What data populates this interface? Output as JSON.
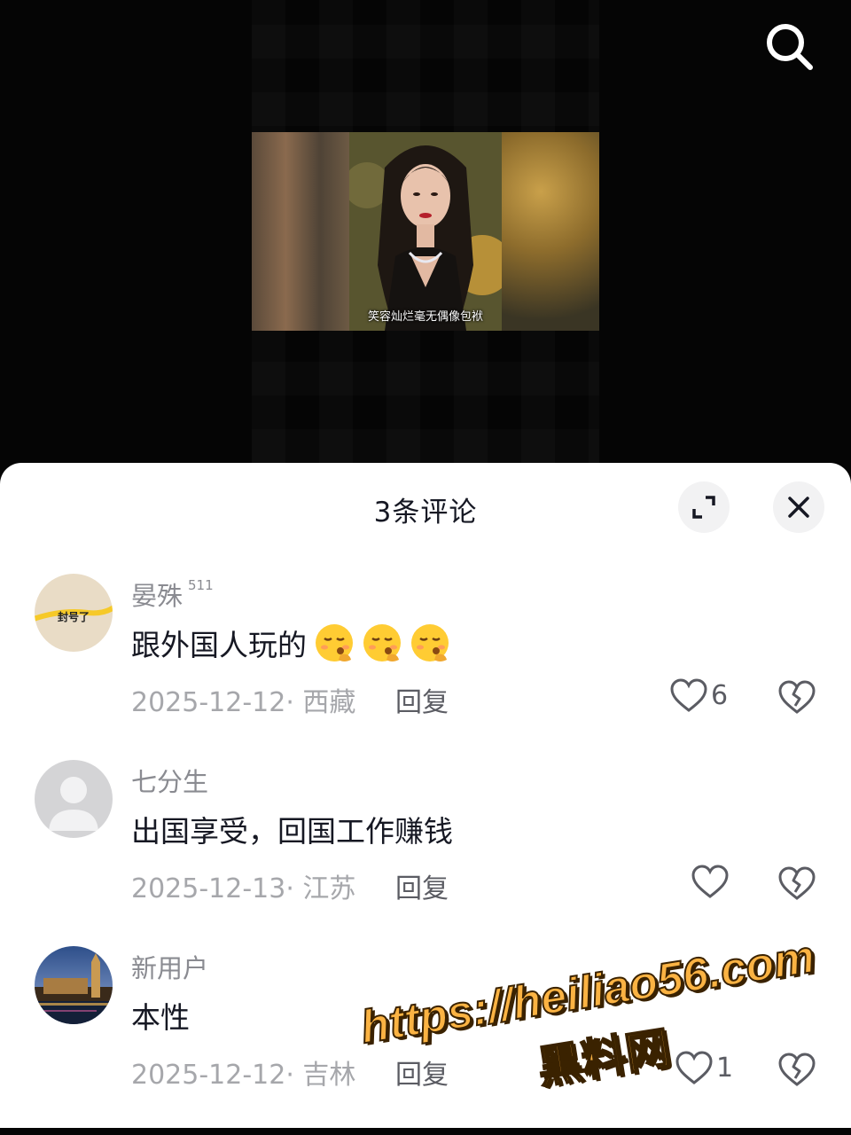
{
  "video": {
    "caption": "笑容灿烂毫无偶像包袱"
  },
  "header": {
    "title": "3条评论"
  },
  "comments": [
    {
      "username": "晏殊",
      "level": "511",
      "avatar_text": "封号了",
      "text": "跟外国人玩的",
      "emojis": [
        "kissing-face-emoji",
        "kissing-face-emoji",
        "kissing-face-emoji"
      ],
      "meta": "2025-12-12· 西藏",
      "reply_label": "回复",
      "likes": "6"
    },
    {
      "username": "七分生",
      "text": "出国享受，回国工作赚钱",
      "meta": "2025-12-13· 江苏",
      "reply_label": "回复",
      "likes": ""
    },
    {
      "username": "新用户",
      "text": "本性",
      "meta": "2025-12-12· 吉林",
      "reply_label": "回复",
      "likes": "1"
    }
  ],
  "watermark": {
    "url": "https://heiliao56.com",
    "name": "黑料网"
  },
  "colors": {
    "sheet_bg": "#ffffff",
    "username": "#8a8b91",
    "text": "#161823",
    "meta": "#a6a7ab",
    "watermark": "#fbb343"
  }
}
